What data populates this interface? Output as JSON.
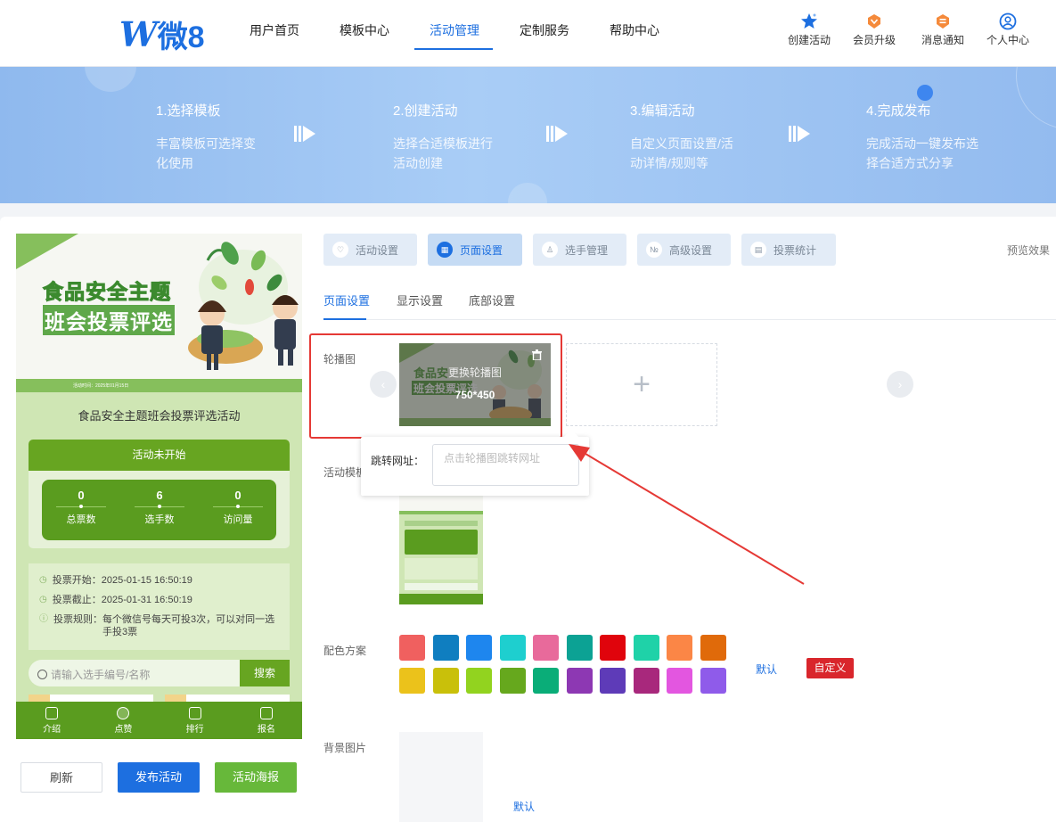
{
  "brand": {
    "logo_mark": "W",
    "logo_text": "微8",
    "accent": "#1d6fe0"
  },
  "nav": {
    "items": [
      "用户首页",
      "模板中心",
      "活动管理",
      "定制服务",
      "帮助中心"
    ],
    "active": "活动管理",
    "right": [
      {
        "label": "创建活动",
        "icon": "star-icon"
      },
      {
        "label": "会员升级",
        "icon": "vip-badge-icon"
      },
      {
        "label": "消息通知",
        "icon": "notification-badge-icon"
      },
      {
        "label": "个人中心",
        "icon": "user-icon"
      }
    ]
  },
  "steps": [
    {
      "title": "1.选择模板",
      "desc": "丰富模板可选择变化使用"
    },
    {
      "title": "2.创建活动",
      "desc": "选择合适模板进行活动创建"
    },
    {
      "title": "3.编辑活动",
      "desc": "自定义页面设置/活动详情/规则等"
    },
    {
      "title": "4.完成发布",
      "desc": "完成活动一键发布选择合适方式分享"
    }
  ],
  "preview": {
    "poster_title_1": "食品安全主题",
    "poster_title_2": "班会投票评选",
    "date_strip": "活动时间：2025年01月15日",
    "event_title": "食品安全主题班会投票评选活动",
    "status": "活动未开始",
    "stats": [
      {
        "value": "0",
        "label": "总票数"
      },
      {
        "value": "6",
        "label": "选手数"
      },
      {
        "value": "0",
        "label": "访问量"
      }
    ],
    "info": [
      {
        "label": "投票开始：",
        "value": "2025-01-15 16:50:19"
      },
      {
        "label": "投票截止：",
        "value": "2025-01-31 16:50:19"
      },
      {
        "label": "投票规则：",
        "value": "每个微信号每天可投3次，可以对同一选手投3票"
      }
    ],
    "search_placeholder": "请输入选手编号/名称",
    "search_button": "搜索",
    "tabbar": [
      "介绍",
      "点赞",
      "排行",
      "报名"
    ]
  },
  "actions": {
    "refresh": "刷新",
    "publish": "发布活动",
    "poster": "活动海报"
  },
  "settings": {
    "tabs": [
      "活动设置",
      "页面设置",
      "选手管理",
      "高级设置",
      "投票统计"
    ],
    "active_tab": "页面设置",
    "preview_link": "预览效果",
    "subtabs": [
      "页面设置",
      "显示设置",
      "底部设置"
    ],
    "active_subtab": "页面设置",
    "carousel_label": "轮播图",
    "carousel_change": "更换轮播图",
    "carousel_size": "750*450",
    "jump_label": "跳转网址：",
    "jump_placeholder": "点击轮播图跳转网址",
    "template_label": "活动模板",
    "template_label_visible": "活动模板",
    "color_label": "配色方案",
    "color_default": "默认",
    "color_custom": "自定义",
    "bg_label": "背景图片",
    "bg_default": "默认",
    "colors_row1": [
      "#f0605f",
      "#0f7ec0",
      "#1e86ee",
      "#1ecfcf",
      "#e86a9b",
      "#0ca294",
      "#e0040c",
      "#1fd2a8",
      "#fb8646",
      "#e06a0a"
    ],
    "colors_row2": [
      "#ebc21b",
      "#c9c00a",
      "#92d31f",
      "#66a81d",
      "#0aad78",
      "#8d38b3",
      "#5e3bb8",
      "#a8287c",
      "#e356e0",
      "#8f5bea"
    ]
  }
}
